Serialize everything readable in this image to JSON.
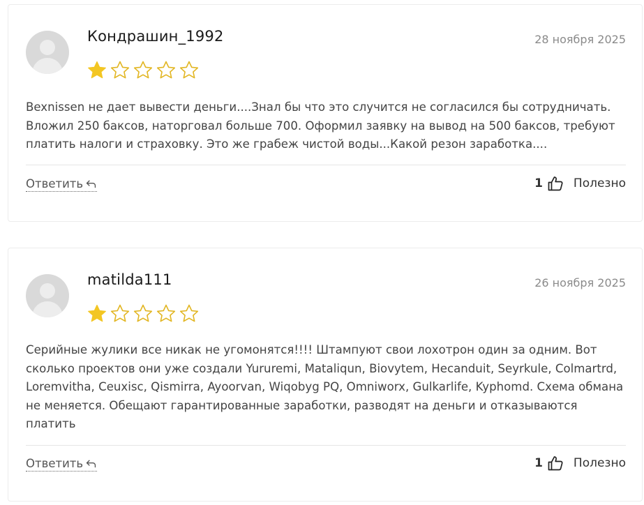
{
  "colors": {
    "star_filled": "#F3C623",
    "star_empty_stroke": "#E2B623",
    "date": "#8a8a8a",
    "text": "#444444"
  },
  "reviews": [
    {
      "username": "Кондрашин_1992",
      "date": "28 ноября 2025",
      "rating": 1,
      "rating_max": 5,
      "text": "Bexnissen не дает вывести деньги....Знал бы что это случится не согласился бы сотрудничать. Вложил 250 баксов, наторговал больше 700. Оформил заявку на вывод на 500 баксов, требуют платить налоги и страховку. Это же грабеж чистой воды...Какой резон заработка....",
      "reply_label": "Ответить",
      "helpful_count": "1",
      "helpful_label": "Полезно"
    },
    {
      "username": "matilda111",
      "date": "26 ноября 2025",
      "rating": 1,
      "rating_max": 5,
      "text": "Серийные жулики все никак не угомонятся!!!! Штампуют свои лохотрон один за одним. Вот сколько проектов они уже создали Yururemi, Mataliqun, Biovytem, Hecanduit, Seyrkule, Colmartrd, Loremvitha, Ceuxisc, Qismirra, Ayoorvan, Wiqobyg PQ, Omniworx, Gulkarlife, Kyphomd. Схема обмана не меняется. Обещают гарантированные заработки, разводят на деньги и отказываются платить",
      "reply_label": "Ответить",
      "helpful_count": "1",
      "helpful_label": "Полезно"
    }
  ],
  "icons": {
    "avatar": "user-placeholder-icon",
    "star": "star-icon",
    "reply": "reply-arrow-icon",
    "helpful": "thumbs-up-icon"
  }
}
